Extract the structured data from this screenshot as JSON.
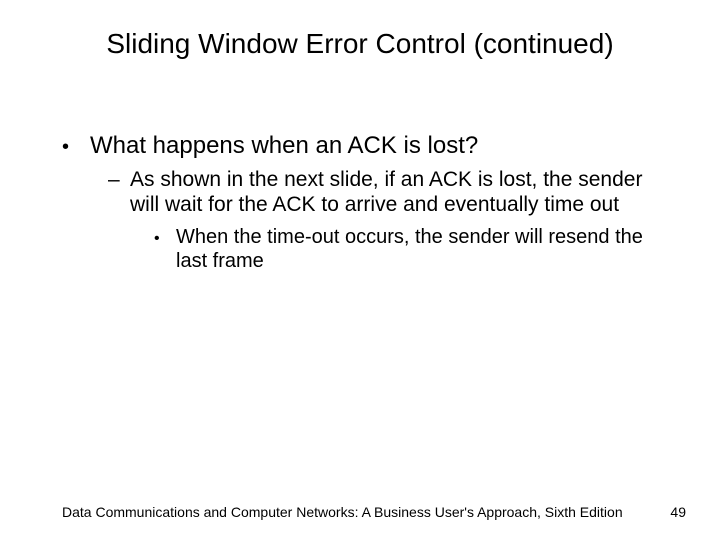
{
  "title": "Sliding Window Error Control (continued)",
  "bullets": {
    "l1": "What happens when an ACK is lost?",
    "l2": "As shown in the next slide, if an ACK is lost, the sender will wait for the ACK to arrive and eventually time out",
    "l3": "When the time-out occurs, the sender will resend the last frame"
  },
  "footer": "Data Communications and Computer Networks: A Business User's Approach, Sixth Edition",
  "page": "49"
}
